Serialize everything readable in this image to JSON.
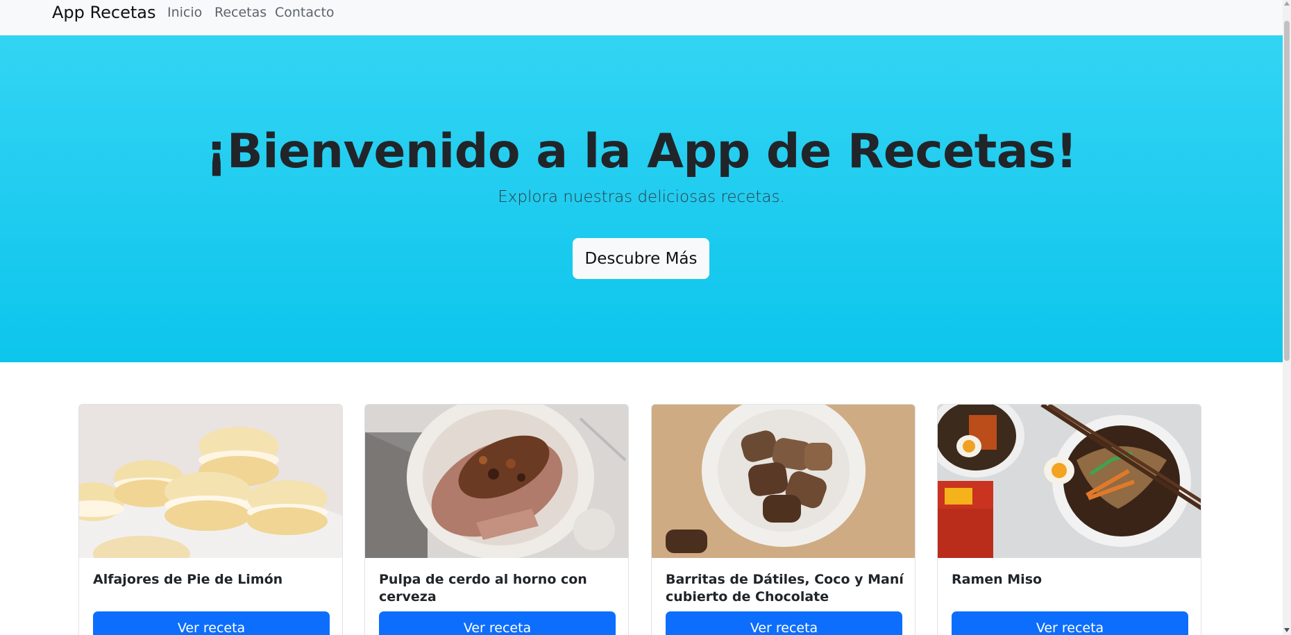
{
  "navbar": {
    "brand": "App Recetas",
    "links": [
      "Inicio",
      "Recetas",
      "Contacto"
    ]
  },
  "hero": {
    "title": "¡Bienvenido a la App de Recetas!",
    "subtitle": "Explora nuestras deliciosas recetas.",
    "button": "Descubre Más"
  },
  "recipes": [
    {
      "title": "Alfajores de Pie de Limón",
      "button": "Ver receta"
    },
    {
      "title": "Pulpa de cerdo al horno con cerveza",
      "button": "Ver receta"
    },
    {
      "title": "Barritas de Dátiles, Coco y Maní cubierto de Chocolate",
      "button": "Ver receta"
    },
    {
      "title": "Ramen Miso",
      "button": "Ver receta"
    }
  ],
  "colors": {
    "hero": "#0dcaf0",
    "primary": "#0d6efd",
    "navbar": "#f8f9fa"
  }
}
